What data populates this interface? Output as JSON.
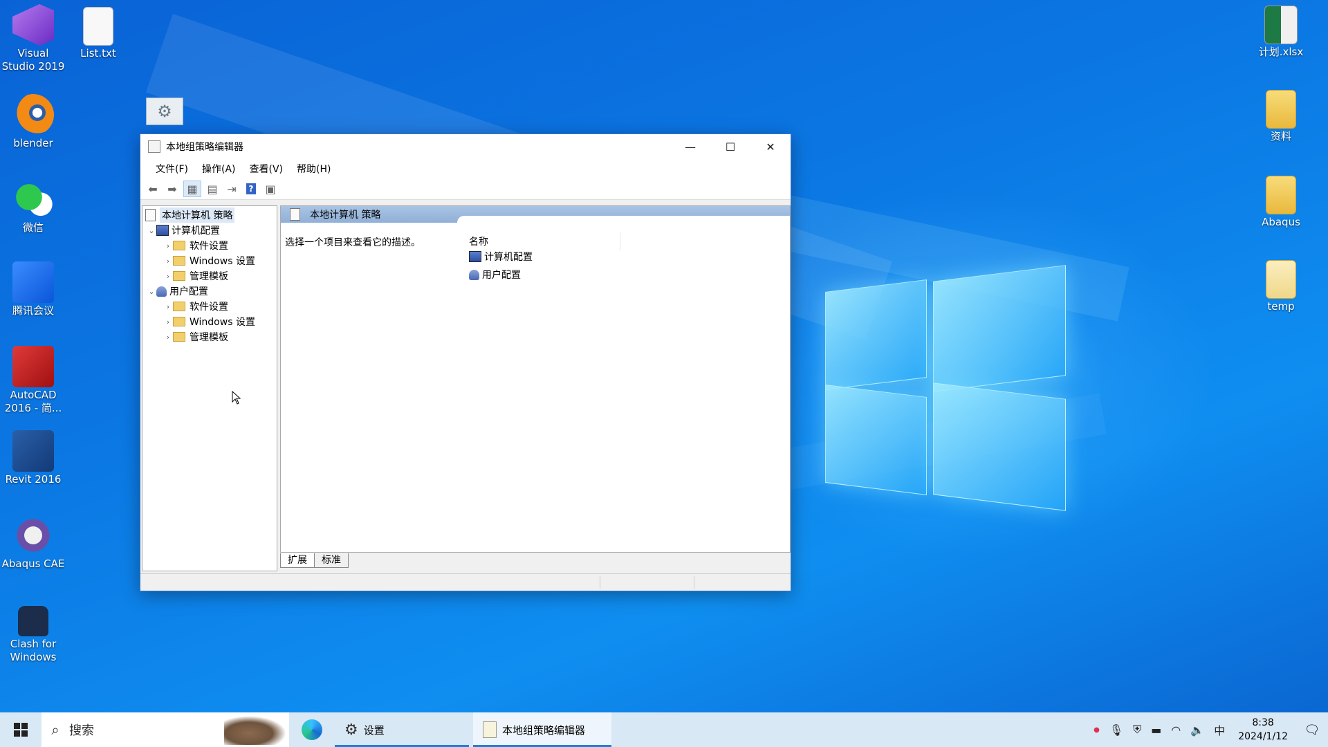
{
  "desktop": {
    "icons_left": [
      {
        "label": "Visual\nStudio 2019",
        "name": "visual-studio-icon"
      },
      {
        "label": "List.txt",
        "name": "text-file-icon"
      },
      {
        "label": "blender",
        "name": "blender-icon"
      },
      {
        "label": "微信",
        "name": "wechat-icon"
      },
      {
        "label": "腾讯会议",
        "name": "tencent-meeting-icon"
      },
      {
        "label": "AutoCAD\n2016 - 简...",
        "name": "autocad-icon"
      },
      {
        "label": "Revit 2016",
        "name": "revit-icon"
      },
      {
        "label": "Abaqus CAE",
        "name": "abaqus-cae-icon"
      },
      {
        "label": "Clash for\nWindows",
        "name": "clash-icon"
      }
    ],
    "icons_right": [
      {
        "label": "计划.xlsx",
        "name": "excel-file-icon"
      },
      {
        "label": "资料",
        "name": "folder-icon"
      },
      {
        "label": "Abaqus",
        "name": "folder-icon"
      },
      {
        "label": "temp",
        "name": "folder-icon"
      }
    ]
  },
  "window": {
    "title": "本地组策略编辑器",
    "menu": [
      "文件(F)",
      "操作(A)",
      "查看(V)",
      "帮助(H)"
    ],
    "tree": {
      "root": "本地计算机 策略",
      "computer_config": "计算机配置",
      "user_config": "用户配置",
      "software_settings": "软件设置",
      "windows_settings": "Windows 设置",
      "admin_templates": "管理模板"
    },
    "detail": {
      "header": "本地计算机 策略",
      "description": "选择一个项目来查看它的描述。",
      "column_name": "名称",
      "items": [
        "计算机配置",
        "用户配置"
      ]
    },
    "tabs": [
      "扩展",
      "标准"
    ]
  },
  "taskbar": {
    "search_placeholder": "搜索",
    "apps": {
      "settings": "设置",
      "gpedit": "本地组策略编辑器"
    },
    "ime": "中",
    "time": "8:38",
    "date": "2024/1/12"
  },
  "colors": {
    "accent": "#1f7fe0",
    "selection": "#dce8f6"
  }
}
